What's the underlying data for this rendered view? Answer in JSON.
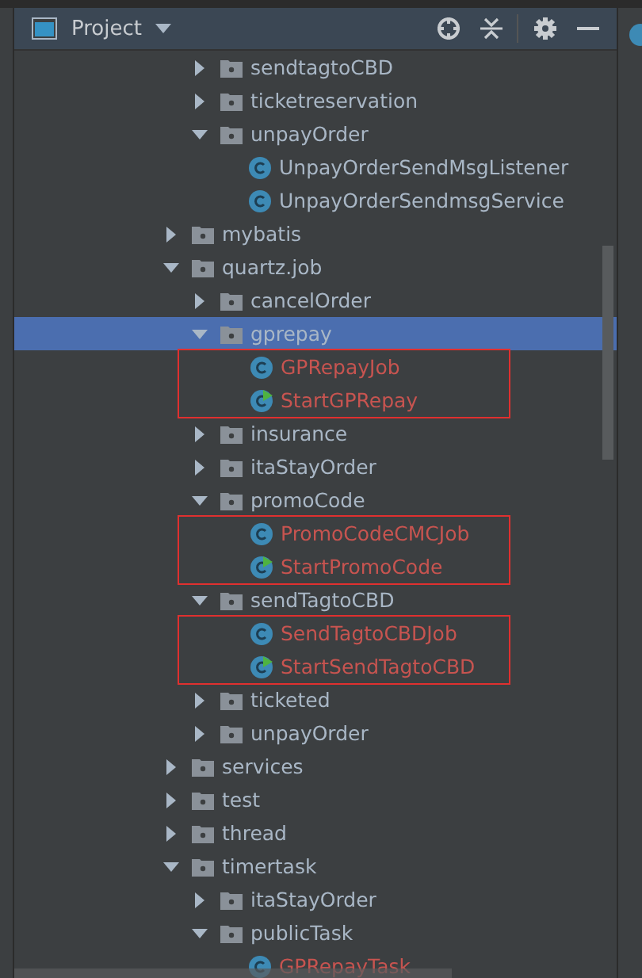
{
  "panel": {
    "title": "Project"
  },
  "tree": [
    {
      "children": [
        {
          "label": "sendtagtoCBD",
          "kind": "folder",
          "expanded": false,
          "selected": false
        },
        {
          "label": "ticketreservation",
          "kind": "folder",
          "expanded": false,
          "selected": false
        },
        {
          "label": "unpayOrder",
          "kind": "folder",
          "expanded": true,
          "selected": false,
          "children": [
            {
              "label": "UnpayOrderSendMsgListener",
              "kind": "class",
              "color": "#a9b7c6",
              "selected": false
            },
            {
              "label": "UnpayOrderSendmsgService",
              "kind": "class",
              "color": "#a9b7c6",
              "selected": false
            }
          ]
        }
      ]
    },
    {
      "label": "mybatis",
      "kind": "folder",
      "expanded": false,
      "selected": false
    },
    {
      "label": "quartz.job",
      "kind": "folder",
      "expanded": true,
      "selected": false,
      "children": [
        {
          "label": "cancelOrder",
          "kind": "folder",
          "expanded": false,
          "selected": false
        },
        {
          "label": "gprepay",
          "kind": "folder",
          "expanded": true,
          "selected": true,
          "children_outlined": true,
          "children": [
            {
              "label": "GPRepayJob",
              "kind": "class",
              "color": "#c75450",
              "selected": false
            },
            {
              "label": "StartGPRepay",
              "kind": "runnable-class",
              "color": "#c75450",
              "selected": false
            }
          ]
        },
        {
          "label": "insurance",
          "kind": "folder",
          "expanded": false,
          "selected": false
        },
        {
          "label": "itaStayOrder",
          "kind": "folder",
          "expanded": false,
          "selected": false
        },
        {
          "label": "promoCode",
          "kind": "folder",
          "expanded": true,
          "selected": false,
          "children_outlined": true,
          "children": [
            {
              "label": "PromoCodeCMCJob",
              "kind": "class",
              "color": "#c75450",
              "selected": false
            },
            {
              "label": "StartPromoCode",
              "kind": "runnable-class",
              "color": "#c75450",
              "selected": false
            }
          ]
        },
        {
          "label": "sendTagtoCBD",
          "kind": "folder",
          "expanded": true,
          "selected": false,
          "children_outlined": true,
          "children": [
            {
              "label": "SendTagtoCBDJob",
              "kind": "class",
              "color": "#c75450",
              "selected": false
            },
            {
              "label": "StartSendTagtoCBD",
              "kind": "runnable-class",
              "color": "#c75450",
              "selected": false
            }
          ]
        },
        {
          "label": "ticketed",
          "kind": "folder",
          "expanded": false,
          "selected": false
        },
        {
          "label": "unpayOrder",
          "kind": "folder",
          "expanded": false,
          "selected": false
        }
      ]
    },
    {
      "label": "services",
      "kind": "folder",
      "expanded": false,
      "selected": false
    },
    {
      "label": "test",
      "kind": "folder",
      "expanded": false,
      "selected": false
    },
    {
      "label": "thread",
      "kind": "folder",
      "expanded": false,
      "selected": false
    },
    {
      "label": "timertask",
      "kind": "folder",
      "expanded": true,
      "selected": false,
      "children": [
        {
          "label": "itaStayOrder",
          "kind": "folder",
          "expanded": false,
          "selected": false
        },
        {
          "label": "publicTask",
          "kind": "folder",
          "expanded": true,
          "selected": false,
          "children": [
            {
              "label": "GPRepayTask",
              "kind": "class",
              "color": "#c75450",
              "selected": false
            }
          ]
        }
      ]
    }
  ]
}
